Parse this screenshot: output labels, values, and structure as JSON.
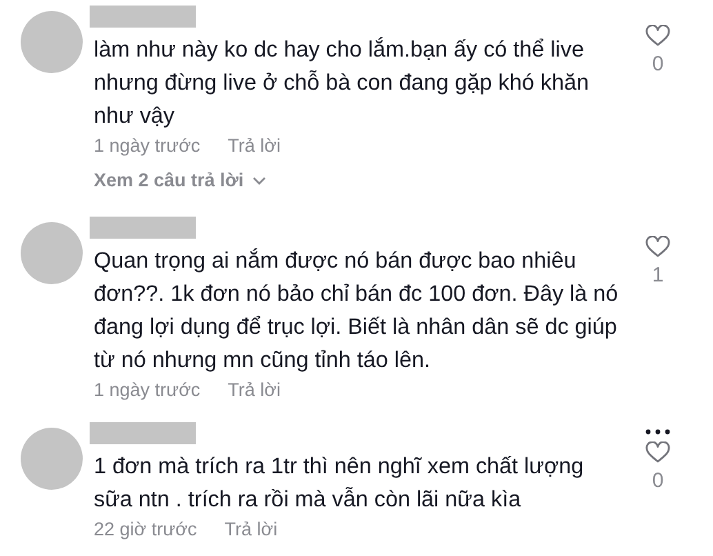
{
  "comments": [
    {
      "text": "làm như này ko dc hay cho lắm.bạn ấy có thể live nhưng đừng live ở chỗ bà con đang gặp khó khăn như vậy",
      "time": "1 ngày trước",
      "reply": "Trả lời",
      "likes": "0",
      "more_menu": false,
      "view_replies": "Xem 2 câu trả lời"
    },
    {
      "text": "Quan trọng ai nắm được nó bán được bao nhiêu đơn??. 1k đơn nó bảo chỉ bán đc 100 đơn. Đây là nó đang lợi dụng để trục lợi. Biết là nhân dân sẽ dc giúp từ nó nhưng mn cũng tỉnh táo lên.",
      "time": "1 ngày trước",
      "reply": "Trả lời",
      "likes": "1",
      "more_menu": false
    },
    {
      "text": "1 đơn mà trích ra 1tr thì nên nghĩ xem chất lượng sữa ntn . trích ra rồi mà vẫn còn lãi nữa kìa",
      "time": "22 giờ trước",
      "reply": "Trả lời",
      "likes": "0",
      "more_menu": true
    }
  ]
}
